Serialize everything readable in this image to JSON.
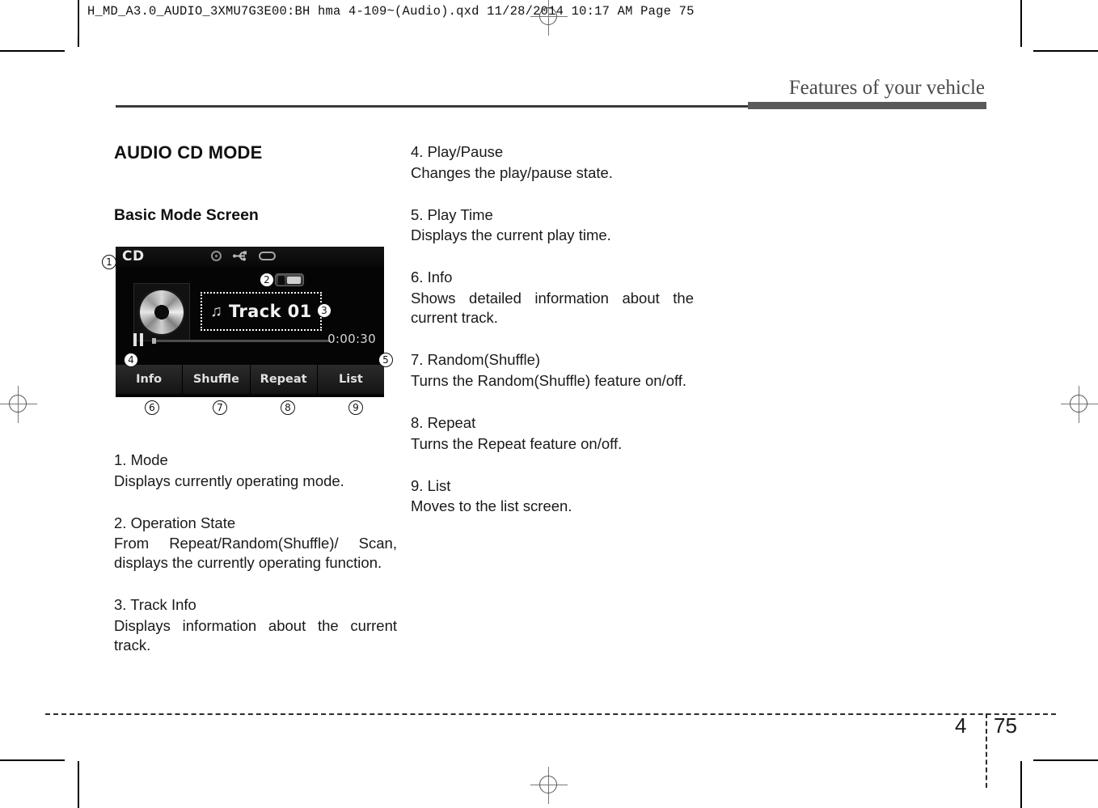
{
  "prepress": {
    "slug": "H_MD_A3.0_AUDIO_3XMU7G3E00:BH hma 4-109~(Audio).qxd  11/28/2014  10:17 AM  Page 75"
  },
  "running_head": {
    "title": "Features of your vehicle"
  },
  "headings": {
    "section": "AUDIO CD MODE",
    "subsection": "Basic Mode Screen"
  },
  "screenshot": {
    "mode_label": "CD",
    "icons": {
      "disc": "disc-icon",
      "usb": "usb-icon",
      "oval": "aux-oval-icon"
    },
    "track_note_glyph": "♫",
    "track_name": "Track 01",
    "play_time": "0:00:30",
    "softkeys": [
      {
        "label": "Info"
      },
      {
        "label": "Shuffle"
      },
      {
        "label": "Repeat"
      },
      {
        "label": "List"
      }
    ],
    "callouts": {
      "c1": "1",
      "c2": "2",
      "c3": "3",
      "c4": "4",
      "c5": "5",
      "c6": "6",
      "c7": "7",
      "c8": "8",
      "c9": "9"
    }
  },
  "left_column": [
    {
      "title": "1. Mode",
      "body": "Displays currently operating mode."
    },
    {
      "title": "2. Operation State",
      "body": "From Repeat/Random(Shuffle)/ Scan, displays the currently operating function."
    },
    {
      "title": "3. Track Info",
      "body": "Displays information about the current track."
    }
  ],
  "right_column": [
    {
      "title": "4. Play/Pause",
      "body": "Changes the play/pause state."
    },
    {
      "title": "5. Play Time",
      "body": "Displays the current play time."
    },
    {
      "title": "6. Info",
      "body": "Shows detailed information about the current track."
    },
    {
      "title": "7. Random(Shuffle)",
      "body": "Turns the Random(Shuffle) feature on/off."
    },
    {
      "title": "8. Repeat",
      "body": "Turns the Repeat feature on/off."
    },
    {
      "title": "9. List",
      "body": "Moves to the list screen."
    }
  ],
  "footer": {
    "chapter": "4",
    "page": "75"
  }
}
